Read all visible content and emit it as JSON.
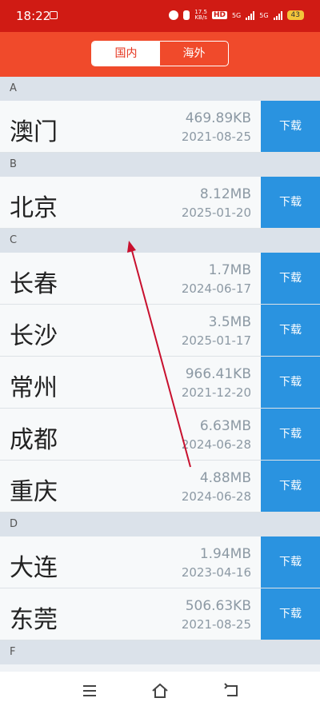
{
  "status": {
    "time": "18:22",
    "speed_top": "17.5",
    "speed_bottom": "KB/s",
    "hd": "HD",
    "net1": "5G",
    "net2": "5G",
    "battery": "43"
  },
  "tabs": [
    {
      "label": "国内",
      "active": true
    },
    {
      "label": "海外",
      "active": false
    }
  ],
  "sections": [
    {
      "letter": "A",
      "items": [
        {
          "city": "澳门",
          "size": "469.89KB",
          "date": "2021-08-25",
          "button": "下载"
        }
      ]
    },
    {
      "letter": "B",
      "items": [
        {
          "city": "北京",
          "size": "8.12MB",
          "date": "2025-01-20",
          "button": "下载"
        }
      ]
    },
    {
      "letter": "C",
      "items": [
        {
          "city": "长春",
          "size": "1.7MB",
          "date": "2024-06-17",
          "button": "下载"
        },
        {
          "city": "长沙",
          "size": "3.5MB",
          "date": "2025-01-17",
          "button": "下载"
        },
        {
          "city": "常州",
          "size": "966.41KB",
          "date": "2021-12-20",
          "button": "下载"
        },
        {
          "city": "成都",
          "size": "6.63MB",
          "date": "2024-06-28",
          "button": "下载"
        },
        {
          "city": "重庆",
          "size": "4.88MB",
          "date": "2024-06-28",
          "button": "下载"
        }
      ]
    },
    {
      "letter": "D",
      "items": [
        {
          "city": "大连",
          "size": "1.94MB",
          "date": "2023-04-16",
          "button": "下载"
        },
        {
          "city": "东莞",
          "size": "506.63KB",
          "date": "2021-08-25",
          "button": "下载"
        }
      ]
    },
    {
      "letter": "F",
      "items": []
    }
  ],
  "colors": {
    "status_bar": "#d01b14",
    "header": "#f04a2b",
    "download_button": "#2a93e0",
    "arrow": "#c8102e"
  },
  "icons": {
    "nav_menu": "menu-icon",
    "nav_home": "home-icon",
    "nav_back": "back-icon"
  }
}
